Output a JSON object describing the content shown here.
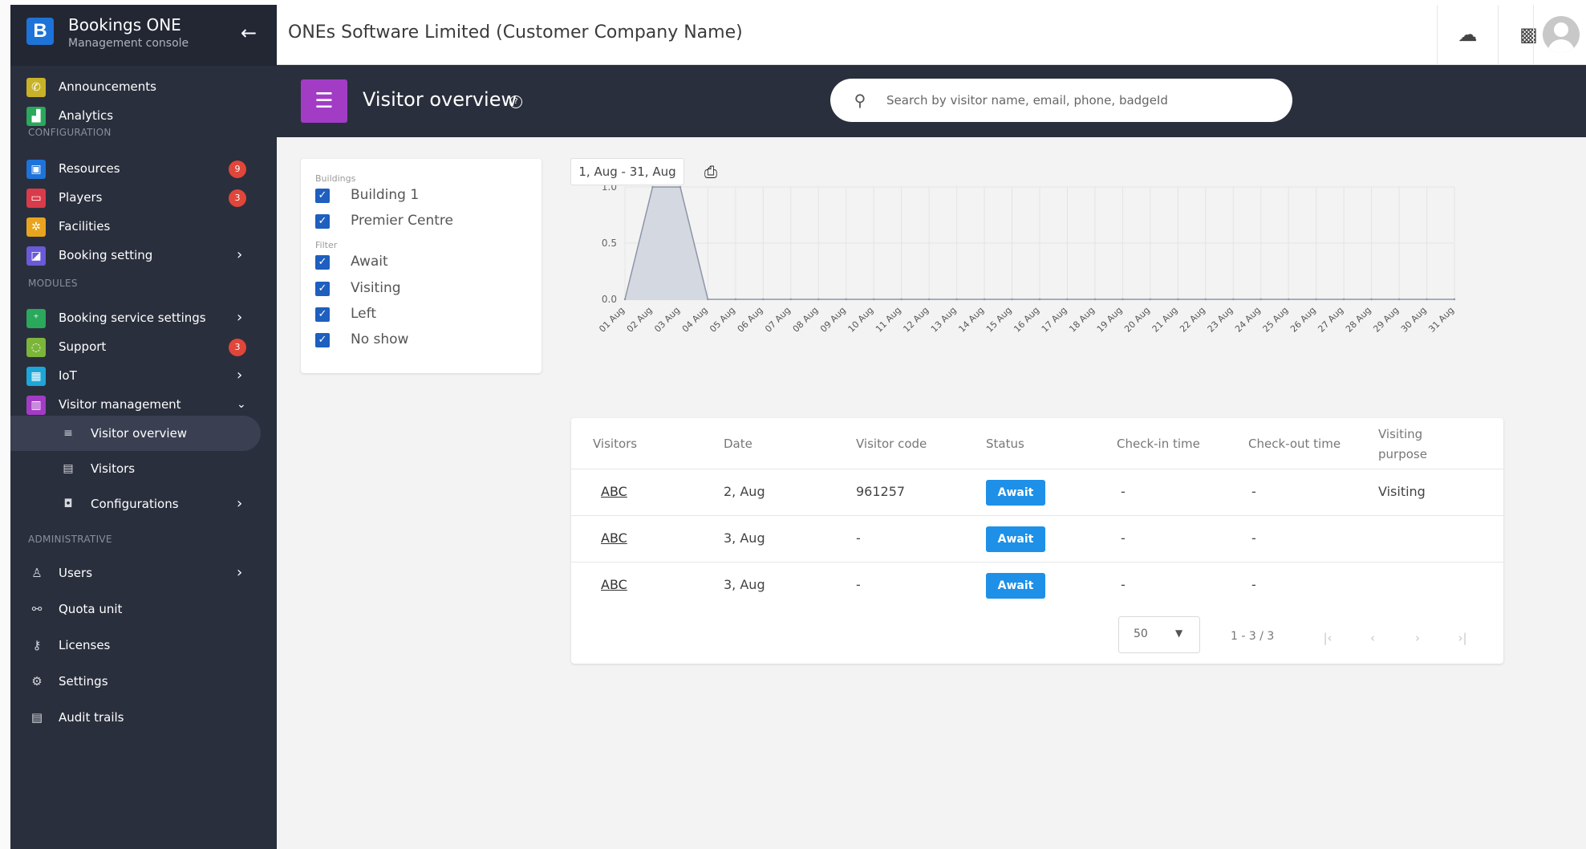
{
  "brand": {
    "title": "Bookings ONE",
    "subtitle": "Management console",
    "logo_letter": "B"
  },
  "sidebar": {
    "items_top": [
      {
        "label": "Announcements",
        "icon": "megaphone-icon",
        "color": "#c8b22a"
      },
      {
        "label": "Analytics",
        "icon": "chart-icon",
        "color": "#2aa85b"
      }
    ],
    "config_section": "CONFIGURATION",
    "config_items": [
      {
        "label": "Resources",
        "icon": "resource-icon",
        "color": "#1d73d8",
        "badge": "9"
      },
      {
        "label": "Players",
        "icon": "monitor-icon",
        "color": "#d93b4a",
        "badge": "3"
      },
      {
        "label": "Facilities",
        "icon": "facility-icon",
        "color": "#e9a41f"
      },
      {
        "label": "Booking setting",
        "icon": "calendar-icon",
        "color": "#6a5ad8"
      }
    ],
    "modules_section": "MODULES",
    "module_items": [
      {
        "label": "Booking service settings",
        "icon": "service-icon",
        "color": "#2aa85b"
      },
      {
        "label": "Support",
        "icon": "support-icon",
        "color": "#7bb53a",
        "badge": "3"
      },
      {
        "label": "IoT",
        "icon": "iot-icon",
        "color": "#1da6d8"
      },
      {
        "label": "Visitor management",
        "icon": "visitor-icon",
        "color": "#a23cc5"
      }
    ],
    "visitor_sub": [
      {
        "label": "Visitor overview",
        "icon": "overview-icon"
      },
      {
        "label": "Visitors",
        "icon": "id-card-icon"
      },
      {
        "label": "Configurations",
        "icon": "config-icon"
      }
    ],
    "admin_section": "ADMINISTRATIVE",
    "admin_items": [
      {
        "label": "Users",
        "icon": "user-icon"
      },
      {
        "label": "Quota unit",
        "icon": "quota-icon"
      },
      {
        "label": "Licenses",
        "icon": "key-icon"
      },
      {
        "label": "Settings",
        "icon": "gear-icon"
      },
      {
        "label": "Audit trails",
        "icon": "audit-icon"
      }
    ]
  },
  "topbar": {
    "company": "ONEs Software Limited (Customer Company Name)"
  },
  "header": {
    "title": "Visitor overview",
    "search_placeholder": "Search by visitor name, email, phone, badgeId"
  },
  "filters": {
    "buildings_label": "Buildings",
    "buildings": [
      "Building 1",
      "Premier Centre"
    ],
    "filter_label": "Filter",
    "statuses": [
      "Await",
      "Visiting",
      "Left",
      "No show"
    ]
  },
  "date_range": "1, Aug - 31, Aug",
  "chart_data": {
    "type": "area",
    "x": [
      "01 Aug",
      "02 Aug",
      "03 Aug",
      "04 Aug",
      "05 Aug",
      "06 Aug",
      "07 Aug",
      "08 Aug",
      "09 Aug",
      "10 Aug",
      "11 Aug",
      "12 Aug",
      "13 Aug",
      "14 Aug",
      "15 Aug",
      "16 Aug",
      "17 Aug",
      "18 Aug",
      "19 Aug",
      "20 Aug",
      "21 Aug",
      "22 Aug",
      "23 Aug",
      "24 Aug",
      "25 Aug",
      "26 Aug",
      "27 Aug",
      "28 Aug",
      "29 Aug",
      "30 Aug",
      "31 Aug"
    ],
    "values": [
      0,
      1,
      1,
      0,
      0,
      0,
      0,
      0,
      0,
      0,
      0,
      0,
      0,
      0,
      0,
      0,
      0,
      0,
      0,
      0,
      0,
      0,
      0,
      0,
      0,
      0,
      0,
      0,
      0,
      0,
      0
    ],
    "y_ticks": [
      "0.0",
      "0.5",
      "1.0"
    ],
    "ylim": [
      0,
      1
    ],
    "grid": true,
    "fill_color": "#d4d8e0",
    "line_color": "#8c95a6"
  },
  "table": {
    "headers": [
      "Visitors",
      "Date",
      "Visitor code",
      "Status",
      "Check-in time",
      "Check-out time",
      "Visiting purpose"
    ],
    "rows": [
      {
        "visitor": "ABC",
        "date": "2, Aug",
        "code": "961257",
        "status": "Await",
        "checkin": "-",
        "checkout": "-",
        "purpose": "Visiting"
      },
      {
        "visitor": "ABC",
        "date": "3, Aug",
        "code": "-",
        "status": "Await",
        "checkin": "-",
        "checkout": "-",
        "purpose": ""
      },
      {
        "visitor": "ABC",
        "date": "3, Aug",
        "code": "-",
        "status": "Await",
        "checkin": "-",
        "checkout": "-",
        "purpose": ""
      }
    ],
    "rows_per_page": "50",
    "page_info": "1 - 3 / 3"
  },
  "colors": {
    "accent": "#1e90e8",
    "sidebar_bg": "#2a2f3d",
    "header_icon": "#a23cc5"
  }
}
